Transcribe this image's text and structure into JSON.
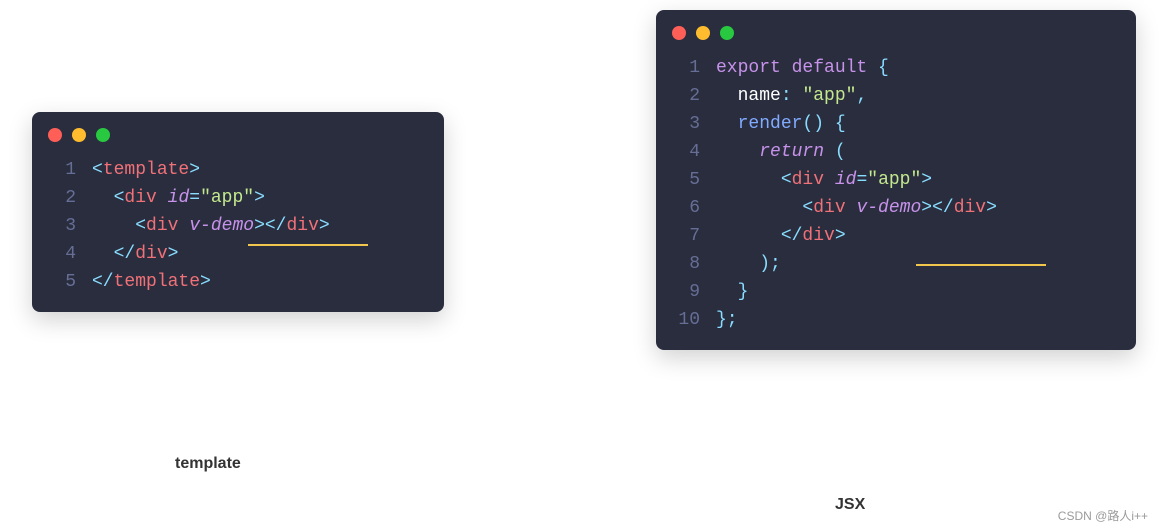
{
  "left": {
    "caption": "template",
    "lines": [
      {
        "n": "1",
        "tokens": [
          {
            "t": "<",
            "c": "c-punct"
          },
          {
            "t": "template",
            "c": "c-tag"
          },
          {
            "t": ">",
            "c": "c-punct"
          }
        ],
        "indent": 0
      },
      {
        "n": "2",
        "tokens": [
          {
            "t": "<",
            "c": "c-punct"
          },
          {
            "t": "div ",
            "c": "c-tag"
          },
          {
            "t": "id",
            "c": "c-attr"
          },
          {
            "t": "=",
            "c": "c-punct"
          },
          {
            "t": "\"app\"",
            "c": "c-str"
          },
          {
            "t": ">",
            "c": "c-punct"
          }
        ],
        "indent": 1
      },
      {
        "n": "3",
        "tokens": [
          {
            "t": "<",
            "c": "c-punct"
          },
          {
            "t": "div ",
            "c": "c-tag"
          },
          {
            "t": "v-demo",
            "c": "c-attr"
          },
          {
            "t": ">",
            "c": "c-punct"
          },
          {
            "t": "</",
            "c": "c-punct"
          },
          {
            "t": "div",
            "c": "c-tag"
          },
          {
            "t": ">",
            "c": "c-punct"
          }
        ],
        "indent": 2
      },
      {
        "n": "4",
        "tokens": [
          {
            "t": "</",
            "c": "c-punct"
          },
          {
            "t": "div",
            "c": "c-tag"
          },
          {
            "t": ">",
            "c": "c-punct"
          }
        ],
        "indent": 1
      },
      {
        "n": "5",
        "tokens": [
          {
            "t": "</",
            "c": "c-punct"
          },
          {
            "t": "template",
            "c": "c-tag"
          },
          {
            "t": ">",
            "c": "c-punct"
          }
        ],
        "indent": 0
      }
    ]
  },
  "right": {
    "caption": "JSX",
    "lines": [
      {
        "n": "1",
        "tokens": [
          {
            "t": "export default ",
            "c": "c-key"
          },
          {
            "t": "{",
            "c": "c-punct"
          }
        ],
        "indent": 0
      },
      {
        "n": "2",
        "tokens": [
          {
            "t": "name",
            "c": "c-prop"
          },
          {
            "t": ": ",
            "c": "c-punct"
          },
          {
            "t": "\"app\"",
            "c": "c-str"
          },
          {
            "t": ",",
            "c": "c-punct"
          }
        ],
        "indent": 1
      },
      {
        "n": "3",
        "tokens": [
          {
            "t": "render",
            "c": "c-fn"
          },
          {
            "t": "() {",
            "c": "c-punct"
          }
        ],
        "indent": 1
      },
      {
        "n": "4",
        "tokens": [
          {
            "t": "return ",
            "c": "c-ret"
          },
          {
            "t": "(",
            "c": "c-punct"
          }
        ],
        "indent": 2
      },
      {
        "n": "5",
        "tokens": [
          {
            "t": "<",
            "c": "c-punct"
          },
          {
            "t": "div ",
            "c": "c-tag"
          },
          {
            "t": "id",
            "c": "c-attr"
          },
          {
            "t": "=",
            "c": "c-punct"
          },
          {
            "t": "\"app\"",
            "c": "c-str"
          },
          {
            "t": ">",
            "c": "c-punct"
          }
        ],
        "indent": 3
      },
      {
        "n": "6",
        "tokens": [
          {
            "t": "<",
            "c": "c-punct"
          },
          {
            "t": "div ",
            "c": "c-tag"
          },
          {
            "t": "v-demo",
            "c": "c-attr"
          },
          {
            "t": ">",
            "c": "c-punct"
          },
          {
            "t": "</",
            "c": "c-punct"
          },
          {
            "t": "div",
            "c": "c-tag"
          },
          {
            "t": ">",
            "c": "c-punct"
          }
        ],
        "indent": 4
      },
      {
        "n": "7",
        "tokens": [
          {
            "t": "</",
            "c": "c-punct"
          },
          {
            "t": "div",
            "c": "c-tag"
          },
          {
            "t": ">",
            "c": "c-punct"
          }
        ],
        "indent": 3
      },
      {
        "n": "8",
        "tokens": [
          {
            "t": ");",
            "c": "c-punct"
          }
        ],
        "indent": 2
      },
      {
        "n": "9",
        "tokens": [
          {
            "t": "}",
            "c": "c-punct"
          }
        ],
        "indent": 1
      },
      {
        "n": "10",
        "tokens": [
          {
            "t": "};",
            "c": "c-punct"
          }
        ],
        "indent": 0
      }
    ]
  },
  "watermark": "CSDN @路人i++"
}
